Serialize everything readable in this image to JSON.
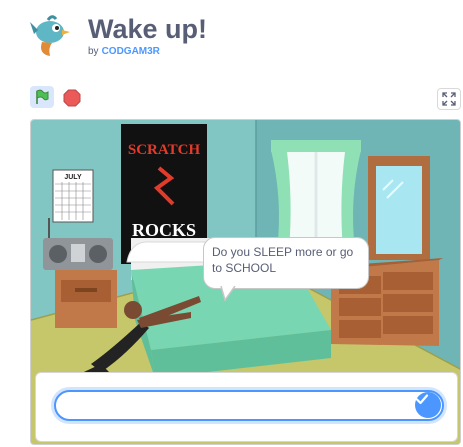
{
  "project": {
    "title": "Wake up!",
    "by_label": "by",
    "author": "CODGAM3R"
  },
  "controls": {
    "green_flag": "green-flag-icon",
    "stop": "stop-sign-icon",
    "fullscreen": "fullscreen-icon"
  },
  "stage": {
    "poster_text_top": "SCRATCH",
    "poster_text_bottom": "ROCKS",
    "calendar_month": "JULY",
    "speech_bubble": "Do you SLEEP more or go to SCHOOL",
    "ask_input_value": ""
  },
  "colors": {
    "accent": "#4c97ff",
    "title": "#575e75",
    "wall": "#82c6c4",
    "floor": "#c5c76a"
  }
}
